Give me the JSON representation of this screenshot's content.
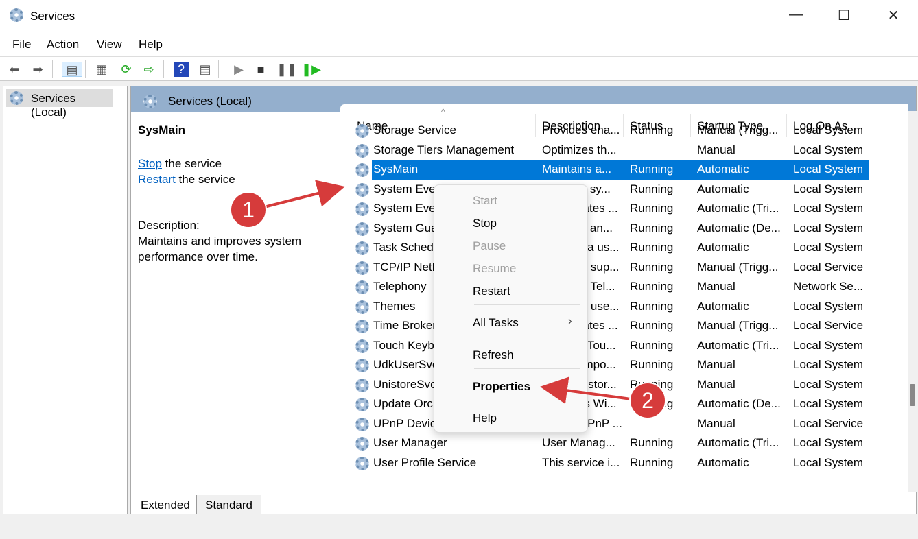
{
  "window": {
    "title": "Services",
    "minimize": "—",
    "maximize": "☐",
    "close": "✕"
  },
  "menubar": [
    "File",
    "Action",
    "View",
    "Help"
  ],
  "toolbar": {
    "icons": [
      "back-icon",
      "forward-icon",
      "show-hide-tree-icon",
      "properties-icon",
      "refresh-icon",
      "export-list-icon",
      "help-icon",
      "show-action-pane-icon",
      "start-icon",
      "stop-icon",
      "pause-icon",
      "restart-icon"
    ]
  },
  "tree": {
    "item": "Services (Local)"
  },
  "banner": "Services (Local)",
  "detail": {
    "service": "SysMain",
    "stop_link": "Stop",
    "stop_rest": " the service",
    "restart_link": "Restart",
    "restart_rest": " the service",
    "desc_label": "Description:",
    "desc": "Maintains and improves system performance over time."
  },
  "columns": [
    "Name",
    "Description",
    "Status",
    "Startup Type",
    "Log On As"
  ],
  "rows": [
    [
      "Storage Service",
      "Provides ena...",
      "Running",
      "Manual (Trigg...",
      "Local System"
    ],
    [
      "Storage Tiers Management",
      "Optimizes th...",
      "",
      "Manual",
      "Local System"
    ],
    [
      "SysMain",
      "Maintains a...",
      "Running",
      "Automatic",
      "Local System"
    ],
    [
      "System Event Notification Service",
      "Monitors sy...",
      "Running",
      "Automatic",
      "Local System"
    ],
    [
      "System Events Broker",
      "Coordinates ...",
      "Running",
      "Automatic (Tri...",
      "Local System"
    ],
    [
      "System Guard Runtime Monitor Broker",
      "Monitors an...",
      "Running",
      "Automatic (De...",
      "Local System"
    ],
    [
      "Task Scheduler",
      "Enables a us...",
      "Running",
      "Automatic",
      "Local System"
    ],
    [
      "TCP/IP NetBIOS Helper",
      "Provides sup...",
      "Running",
      "Manual (Trigg...",
      "Local Service"
    ],
    [
      "Telephony",
      "Provides Tel...",
      "Running",
      "Manual",
      "Network Se..."
    ],
    [
      "Themes",
      "Provides use...",
      "Running",
      "Automatic",
      "Local System"
    ],
    [
      "Time Broker",
      "Coordinates ...",
      "Running",
      "Manual (Trigg...",
      "Local Service"
    ],
    [
      "Touch Keyboard and Handwriting Panel Service",
      "Enables Tou...",
      "Running",
      "Automatic (Tri...",
      "Local System"
    ],
    [
      "UdkUserSvc",
      "Shell compo...",
      "Running",
      "Manual",
      "Local System"
    ],
    [
      "UnistoreSvc",
      "Handles stor...",
      "Running",
      "Manual",
      "Local System"
    ],
    [
      "Update Orchestrator Service",
      "Manages Wi...",
      "Running",
      "Automatic (De...",
      "Local System"
    ],
    [
      "UPnP Device Host",
      "Allows UPnP ...",
      "",
      "Manual",
      "Local Service"
    ],
    [
      "User Manager",
      "User Manag...",
      "Running",
      "Automatic (Tri...",
      "Local System"
    ],
    [
      "User Profile Service",
      "This service i...",
      "Running",
      "Automatic",
      "Local System"
    ]
  ],
  "selected_row": 2,
  "context_menu": {
    "start": "Start",
    "stop": "Stop",
    "pause": "Pause",
    "resume": "Resume",
    "restart": "Restart",
    "all_tasks": "All Tasks",
    "submenu_arrow": "›",
    "refresh": "Refresh",
    "properties": "Properties",
    "help": "Help"
  },
  "tabs": [
    "Extended",
    "Standard"
  ],
  "callouts": [
    "1",
    "2"
  ],
  "colors": {
    "selection": "#0078d7",
    "banner": "#94afcd",
    "callout": "#d63b3b"
  }
}
